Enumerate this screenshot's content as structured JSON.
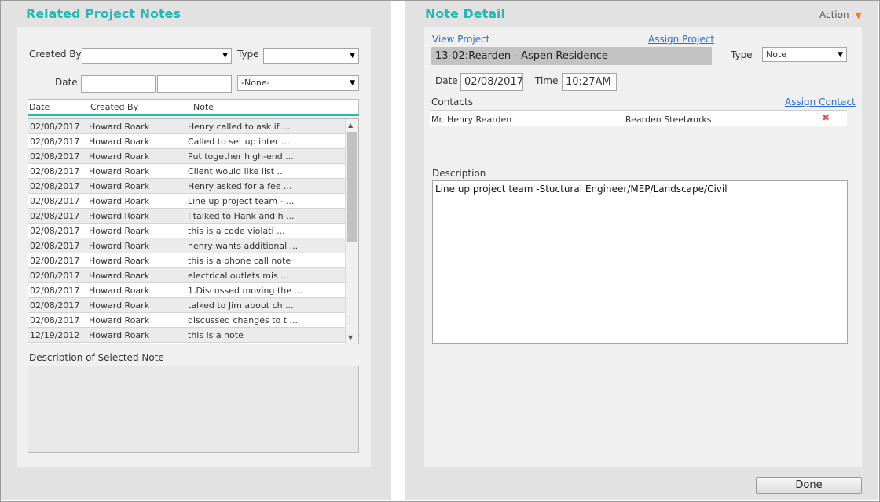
{
  "left": {
    "title": "Related Project Notes",
    "filters": {
      "created_by_label": "Created By",
      "created_by_value": "",
      "type_label": "Type",
      "type_value": "",
      "date_label": "Date",
      "date_from": "",
      "date_to": "",
      "date_range_value": "-None-"
    },
    "columns": [
      "Date",
      "Created By",
      "Note"
    ],
    "rows": [
      {
        "date": "02/08/2017",
        "by": "Howard Roark",
        "note": "Henry called to ask if ..."
      },
      {
        "date": "02/08/2017",
        "by": "Howard Roark",
        "note": "Called to set up inter ..."
      },
      {
        "date": "02/08/2017",
        "by": "Howard Roark",
        "note": "Put together high-end ..."
      },
      {
        "date": "02/08/2017",
        "by": "Howard Roark",
        "note": "Client would like list ..."
      },
      {
        "date": "02/08/2017",
        "by": "Howard Roark",
        "note": "Henry asked for a fee ..."
      },
      {
        "date": "02/08/2017",
        "by": "Howard Roark",
        "note": "Line up project team - ..."
      },
      {
        "date": "02/08/2017",
        "by": "Howard Roark",
        "note": "I talked to Hank and h ..."
      },
      {
        "date": "02/08/2017",
        "by": "Howard Roark",
        "note": "this is a code violati ..."
      },
      {
        "date": "02/08/2017",
        "by": "Howard Roark",
        "note": "henry wants additional ..."
      },
      {
        "date": "02/08/2017",
        "by": "Howard Roark",
        "note": "this is a phone call note"
      },
      {
        "date": "02/08/2017",
        "by": "Howard Roark",
        "note": "electrical outlets mis ..."
      },
      {
        "date": "02/08/2017",
        "by": "Howard Roark",
        "note": "1.Discussed moving the ..."
      },
      {
        "date": "02/08/2017",
        "by": "Howard Roark",
        "note": "talked to Jim about ch ..."
      },
      {
        "date": "02/08/2017",
        "by": "Howard Roark",
        "note": "discussed changes to t ..."
      },
      {
        "date": "12/19/2012",
        "by": "Howard Roark",
        "note": "this is a note"
      }
    ],
    "description_label": "Description of Selected Note",
    "description_value": ""
  },
  "right": {
    "title": "Note Detail",
    "action_label": "Action",
    "view_project_label": "View Project",
    "assign_project_label": "Assign Project",
    "project_value": "13-02:Rearden - Aspen Residence",
    "type_label": "Type",
    "type_value": "Note",
    "date_label": "Date",
    "date_value": "02/08/2017",
    "time_label": "Time",
    "time_value": "10:27AM",
    "contacts_label": "Contacts",
    "assign_contact_label": "Assign Contact",
    "contacts": [
      {
        "name": "Mr. Henry Rearden",
        "company": "Rearden Steelworks"
      }
    ],
    "description_label": "Description",
    "description_value": "Line up project team -Stuctural Engineer/MEP/Landscape/Civil",
    "done_label": "Done"
  },
  "colors": {
    "accent": "#29b6b6",
    "link": "#2a6ecb",
    "action_arrow": "#f07f1a",
    "remove_icon": "#d9534f"
  }
}
